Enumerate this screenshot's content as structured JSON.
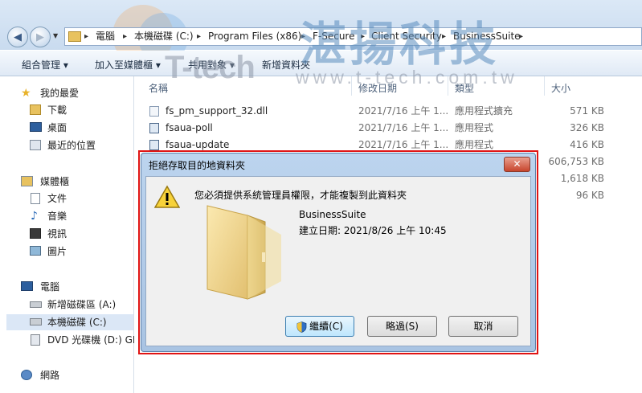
{
  "address": {
    "crumbs": [
      "電腦",
      "本機磁碟 (C:)",
      "Program Files (x86)",
      "F-Secure",
      "Client Security",
      "BusinessSuite"
    ]
  },
  "watermark": {
    "brand": "T-tech",
    "title": "湛揚科技",
    "url": "www.t-tech.com.tw"
  },
  "toolbar": {
    "organize": "組合管理 ▾",
    "include_library": "加入至媒體櫃 ▾",
    "share": "共用對象 ▾",
    "new_folder": "新增資料夾"
  },
  "sidebar": {
    "favorites": "我的最愛",
    "downloads": "下載",
    "desktop": "桌面",
    "recent": "最近的位置",
    "libraries": "媒體櫃",
    "documents": "文件",
    "music": "音樂",
    "videos": "視訊",
    "pictures": "圖片",
    "computer": "電腦",
    "drive_a": "新增磁碟區 (A:)",
    "drive_c": "本機磁碟 (C:)",
    "drive_d": "DVD 光碟機 (D:) GR",
    "network": "網路"
  },
  "columns": {
    "name": "名稱",
    "date": "修改日期",
    "type": "類型",
    "size": "大小"
  },
  "files": [
    {
      "name": "fs_pm_support_32.dll",
      "date": "2021/7/16 上午 1...",
      "type": "應用程式擴充",
      "size": "571 KB"
    },
    {
      "name": "fsaua-poll",
      "date": "2021/7/16 上午 1...",
      "type": "應用程式",
      "size": "326 KB"
    },
    {
      "name": "fsaua-update",
      "date": "2021/7/16 上午 1...",
      "type": "應用程式",
      "size": "416 KB"
    },
    {
      "name": "",
      "date": "",
      "type": "",
      "size": "606,753 KB"
    },
    {
      "name": "",
      "date": "",
      "type": "",
      "size": "1,618 KB"
    },
    {
      "name": "",
      "date": "",
      "type": "",
      "size": "96 KB"
    }
  ],
  "dialog": {
    "title": "拒絕存取目的地資料夾",
    "close": "✕",
    "message": "您必須提供系統管理員權限，才能複製到此資料夾",
    "item_name": "BusinessSuite",
    "item_date": "建立日期: 2021/8/26 上午 10:45",
    "continue_label": "繼續(C)",
    "skip_label": "略過(S)",
    "cancel_label": "取消"
  }
}
